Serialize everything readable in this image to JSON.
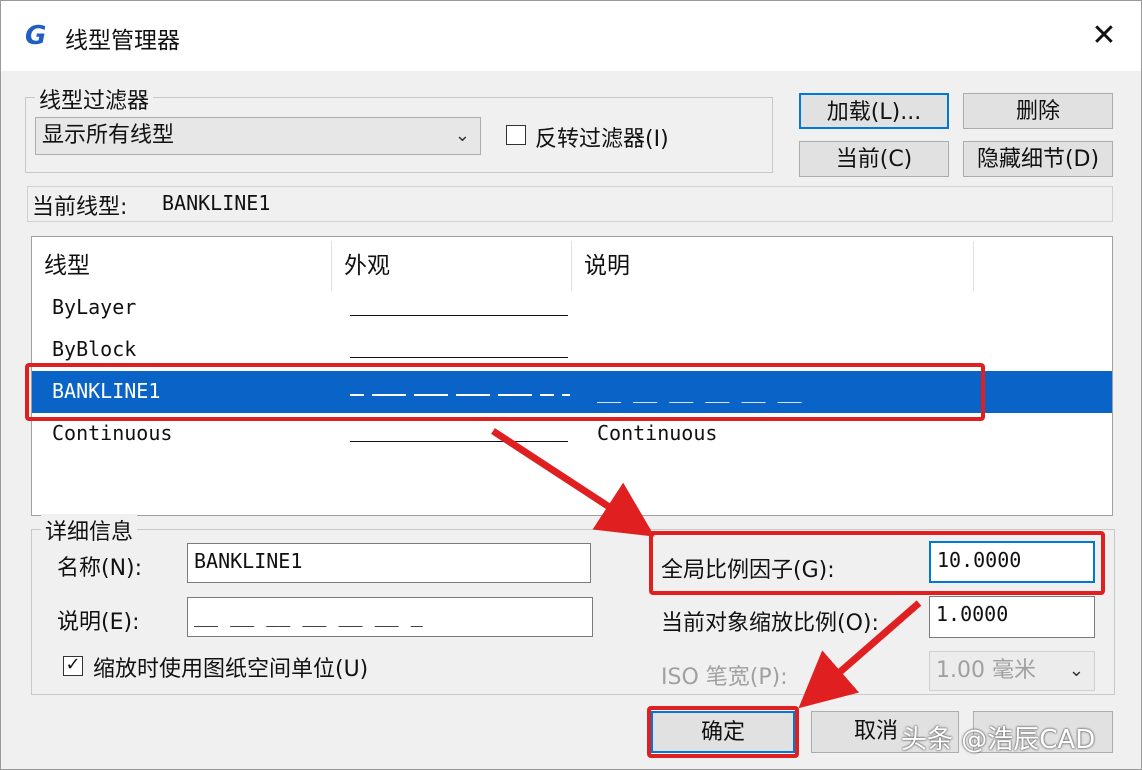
{
  "window": {
    "title": "线型管理器",
    "close_glyph": "✕",
    "app_icon_glyph": "G"
  },
  "filter_group": {
    "legend": "线型过滤器",
    "selected": "显示所有线型",
    "invert_label": "反转过滤器(I)",
    "invert_checked": false
  },
  "buttons": {
    "load": "加载(L)...",
    "delete": "删除",
    "current": "当前(C)",
    "hide_details": "隐藏细节(D)",
    "ok": "确定",
    "cancel": "取消"
  },
  "current_linetype": {
    "label": "当前线型:",
    "value": "BANKLINE1"
  },
  "list": {
    "columns": [
      "线型",
      "外观",
      "说明"
    ],
    "rows": [
      {
        "name": "ByLayer",
        "appearance": "solid",
        "description": ""
      },
      {
        "name": "ByBlock",
        "appearance": "solid",
        "description": ""
      },
      {
        "name": "BANKLINE1",
        "appearance": "dashed",
        "description": "__  __  __  __  __  __",
        "selected": true
      },
      {
        "name": "Continuous",
        "appearance": "solid",
        "description": "Continuous"
      }
    ]
  },
  "details": {
    "legend": "详细信息",
    "name_label": "名称(N):",
    "name_value": "BANKLINE1",
    "desc_label": "说明(E):",
    "desc_value": "__  __  __  __  __  __  _",
    "paper_units_label": "缩放时使用图纸空间单位(U)",
    "paper_units_checked": true,
    "global_scale_label": "全局比例因子(G):",
    "global_scale_value": "10.0000",
    "object_scale_label": "当前对象缩放比例(O):",
    "object_scale_value": "1.0000",
    "iso_pen_label": "ISO 笔宽(P):",
    "iso_pen_value": "1.00 毫米"
  },
  "watermark": "头条 @浩辰CAD",
  "colors": {
    "selection": "#0a64c8",
    "highlight": "#e02020",
    "accent": "#0078d7"
  }
}
